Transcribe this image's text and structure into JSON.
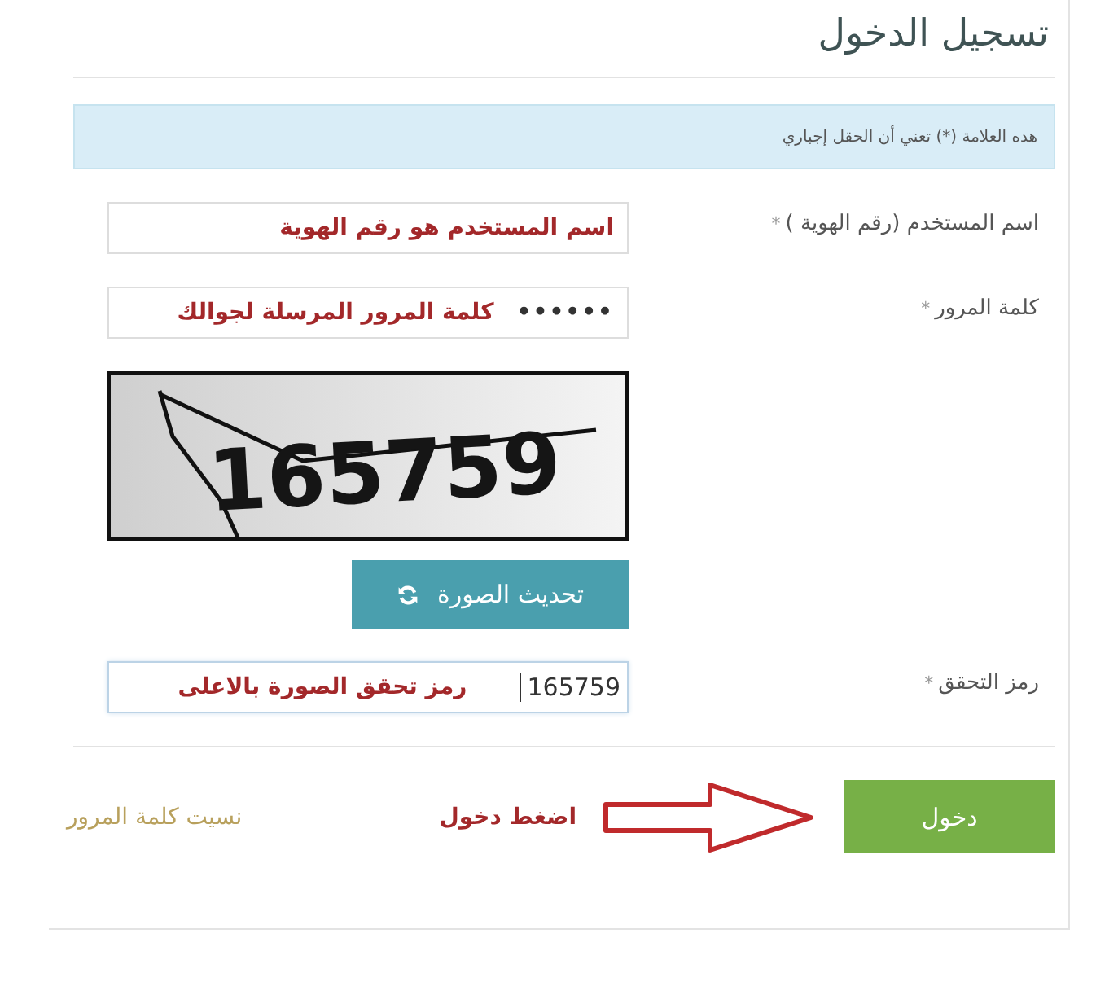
{
  "title": "تسجيل الدخول",
  "notice": "هده العلامة (*) تعني أن الحقل إجباري",
  "fields": [
    {
      "label": "اسم المستخدم (رقم الهوية )",
      "required_mark": "*",
      "annotation": "اسم المستخدم هو رقم الهوية"
    },
    {
      "label": "كلمة المرور",
      "required_mark": "*",
      "value": "••••••",
      "annotation": "كلمة المرور المرسلة لجوالك"
    }
  ],
  "captcha": {
    "text": "165759",
    "refresh_button": "تحديث الصورة"
  },
  "verification": {
    "label": "رمز التحقق",
    "required_mark": "*",
    "value": "165759",
    "annotation": "رمز تحقق الصورة بالاعلى"
  },
  "login_button": "دخول",
  "login_hint": "اضغط دخول",
  "forgot_link": "نسيت كلمة المرور"
}
